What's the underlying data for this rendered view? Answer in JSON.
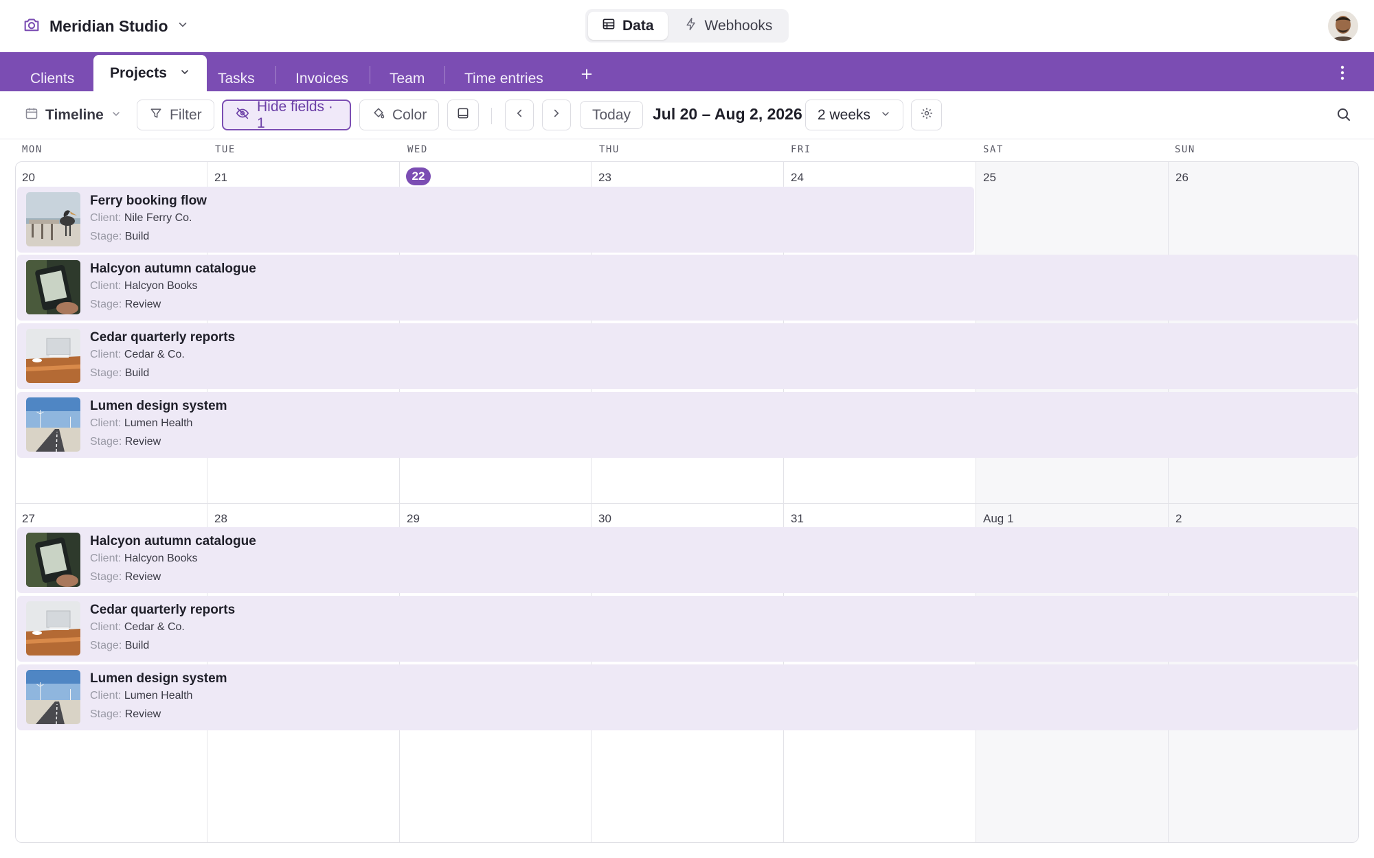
{
  "app": {
    "base_name": "Meridian Studio"
  },
  "header": {
    "segments": [
      {
        "label": "Data",
        "icon": "table-icon",
        "active": true
      },
      {
        "label": "Webhooks",
        "icon": "lightning-icon",
        "active": false
      }
    ]
  },
  "tabs": [
    "Clients",
    "Projects",
    "Tasks",
    "Invoices",
    "Team",
    "Time entries"
  ],
  "active_tab": "Projects",
  "toolbar": {
    "view_name": "Timeline",
    "filter_label": "Filter",
    "hide_fields_label": "Hide fields · 1",
    "color_label": "Color",
    "today_label": "Today",
    "date_range": "Jul 20 – Aug 2, 2026",
    "range_select": "2 weeks"
  },
  "calendar": {
    "weekdays": [
      "MON",
      "TUE",
      "WED",
      "THU",
      "FRI",
      "SAT",
      "SUN"
    ],
    "weeks": [
      {
        "days": [
          "20",
          "21",
          "22",
          "23",
          "24",
          "25",
          "26"
        ],
        "today": "22",
        "events": [
          {
            "title": "Ferry booking flow",
            "client_label": "Client:",
            "client": "Nile Ferry Co.",
            "stage_label": "Stage:",
            "stage": "Build",
            "thumb": "pelican-photo",
            "span_days": 5
          },
          {
            "title": "Halcyon autumn catalogue",
            "client_label": "Client:",
            "client": "Halcyon Books",
            "stage_label": "Stage:",
            "stage": "Review",
            "thumb": "ereader-photo",
            "span_days": 7
          },
          {
            "title": "Cedar quarterly reports",
            "client_label": "Client:",
            "client": "Cedar & Co.",
            "stage_label": "Stage:",
            "stage": "Build",
            "thumb": "desk-photo",
            "span_days": 7
          },
          {
            "title": "Lumen design system",
            "client_label": "Client:",
            "client": "Lumen Health",
            "stage_label": "Stage:",
            "stage": "Review",
            "thumb": "road-photo",
            "span_days": 7
          }
        ]
      },
      {
        "days": [
          "27",
          "28",
          "29",
          "30",
          "31",
          "Aug 1",
          "2"
        ],
        "today": null,
        "events": [
          {
            "title": "Halcyon autumn catalogue",
            "client_label": "Client:",
            "client": "Halcyon Books",
            "stage_label": "Stage:",
            "stage": "Review",
            "thumb": "ereader-photo",
            "span_days": 7
          },
          {
            "title": "Cedar quarterly reports",
            "client_label": "Client:",
            "client": "Cedar & Co.",
            "stage_label": "Stage:",
            "stage": "Build",
            "thumb": "desk-photo",
            "span_days": 7
          },
          {
            "title": "Lumen design system",
            "client_label": "Client:",
            "client": "Lumen Health",
            "stage_label": "Stage:",
            "stage": "Review",
            "thumb": "road-photo",
            "span_days": 7
          }
        ]
      }
    ]
  },
  "colors": {
    "accent": "#7b4db3",
    "event_bg": "#eee9f6",
    "weekend_bg": "#f7f7f9"
  }
}
